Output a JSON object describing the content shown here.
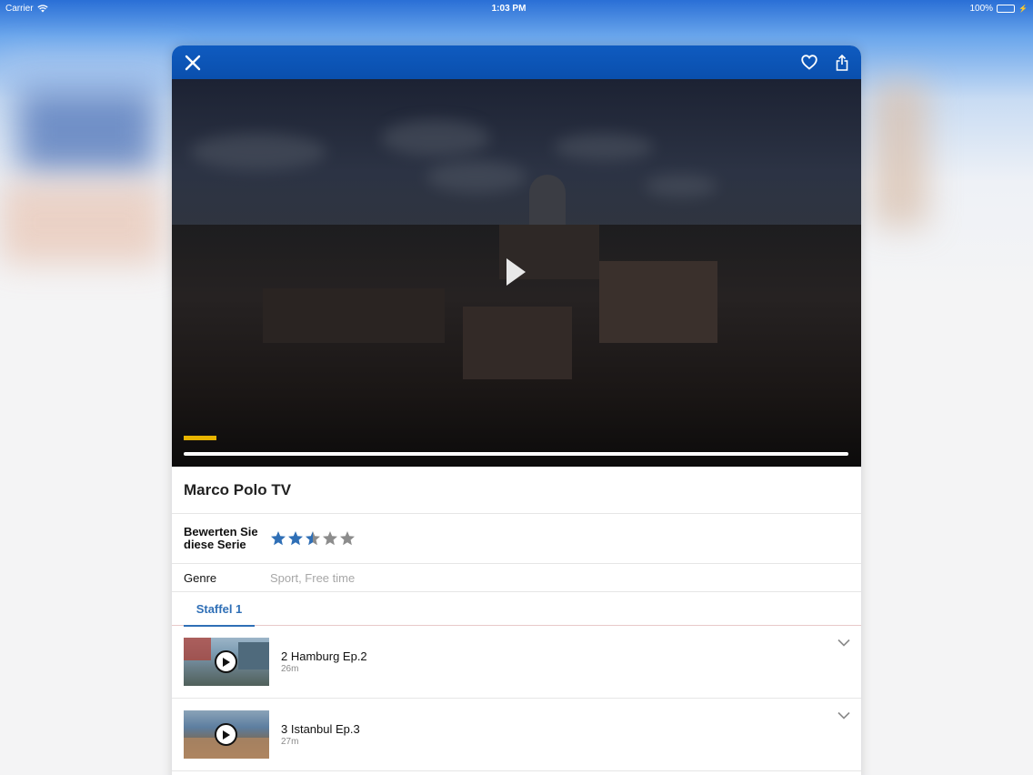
{
  "status_bar": {
    "carrier": "Carrier",
    "time": "1:03 PM",
    "battery": "100%"
  },
  "video": {
    "progress_fraction": 1.0
  },
  "show": {
    "title": "Marco Polo TV"
  },
  "rating": {
    "label": "Bewerten Sie diese Serie",
    "value": 2.5,
    "max": 5,
    "filled_color": "#2f6fb6",
    "empty_color": "#8c8c8c"
  },
  "genre": {
    "label": "Genre",
    "value": "Sport, Free time"
  },
  "tabs": [
    {
      "label": "Staffel 1",
      "selected": true
    }
  ],
  "episodes": [
    {
      "title": "2 Hamburg Ep.2",
      "duration": "26m"
    },
    {
      "title": "3 Istanbul Ep.3",
      "duration": "27m"
    }
  ],
  "colors": {
    "accent": "#2f6fb6",
    "topbar": "#0a52b3"
  },
  "icons": {
    "close": "close-icon",
    "favorite": "heart-icon",
    "share": "share-icon",
    "play": "play-icon",
    "expand": "chevron-down-icon"
  }
}
